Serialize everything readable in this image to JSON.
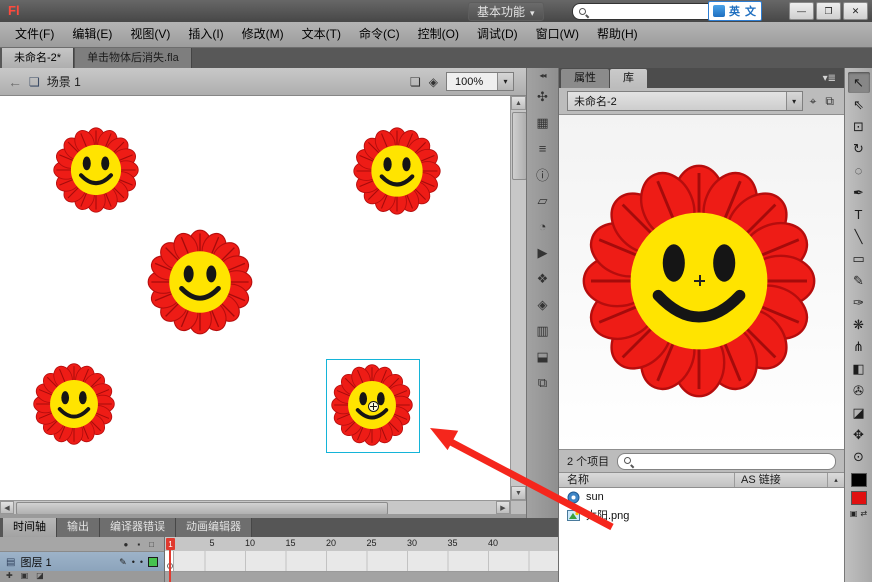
{
  "titlebar": {
    "logo": "Fl",
    "workspace_label": "基本功能",
    "search_placeholder": "",
    "ime_label": "英 文",
    "minimize": "—",
    "maximize": "❐",
    "close": "✕"
  },
  "menubar": {
    "items": [
      "文件(F)",
      "编辑(E)",
      "视图(V)",
      "插入(I)",
      "修改(M)",
      "文本(T)",
      "命令(C)",
      "控制(O)",
      "调试(D)",
      "窗口(W)",
      "帮助(H)"
    ]
  },
  "document_tabs": {
    "tab1": "未命名-2*",
    "tab2": "单击物体后消失.fla"
  },
  "edit_bar": {
    "scene_label": "场景 1",
    "zoom_value": "100%"
  },
  "dock_icons": [
    {
      "name": "color-panel-icon",
      "glyph": "✣"
    },
    {
      "name": "swatches-panel-icon",
      "glyph": "▦"
    },
    {
      "name": "align-panel-icon",
      "glyph": "≡"
    },
    {
      "name": "info-panel-icon",
      "glyph": "ⓘ"
    },
    {
      "name": "transform-panel-icon",
      "glyph": "▱"
    },
    {
      "name": "history-panel-icon",
      "glyph": "◔"
    },
    {
      "name": "motion-presets-panel-icon",
      "glyph": "▶"
    },
    {
      "name": "components-panel-icon",
      "glyph": "❖"
    },
    {
      "name": "code-snippets-panel-icon",
      "glyph": "◈"
    },
    {
      "name": "strings-panel-icon",
      "glyph": "▥"
    },
    {
      "name": "behaviors-panel-icon",
      "glyph": "⬓"
    },
    {
      "name": "project-panel-icon",
      "glyph": "⧉"
    }
  ],
  "right_panel": {
    "tabs": {
      "properties": "属性",
      "library": "库"
    },
    "library": {
      "document_select": "未命名-2",
      "item_count": "2 个项目",
      "search_placeholder": "",
      "columns": {
        "name": "名称",
        "linkage": "AS 链接"
      },
      "items": [
        {
          "name": "sun",
          "type": "symbol"
        },
        {
          "name": "太阳.png",
          "type": "bitmap"
        }
      ]
    }
  },
  "tools": [
    {
      "name": "selection-tool",
      "glyph": "↖",
      "active": true
    },
    {
      "name": "subselection-tool",
      "glyph": "⇖"
    },
    {
      "name": "free-transform-tool",
      "glyph": "⊡"
    },
    {
      "name": "3d-rotation-tool",
      "glyph": "↻"
    },
    {
      "name": "lasso-tool",
      "glyph": "◌"
    },
    {
      "name": "pen-tool",
      "glyph": "✒"
    },
    {
      "name": "text-tool",
      "glyph": "T"
    },
    {
      "name": "line-tool",
      "glyph": "╲"
    },
    {
      "name": "rectangle-tool",
      "glyph": "▭"
    },
    {
      "name": "pencil-tool",
      "glyph": "✎"
    },
    {
      "name": "brush-tool",
      "glyph": "✑"
    },
    {
      "name": "deco-tool",
      "glyph": "❋"
    },
    {
      "name": "bone-tool",
      "glyph": "⋔"
    },
    {
      "name": "paint-bucket-tool",
      "glyph": "◧"
    },
    {
      "name": "eyedropper-tool",
      "glyph": "✇"
    },
    {
      "name": "eraser-tool",
      "glyph": "◪"
    },
    {
      "name": "hand-tool",
      "glyph": "✥"
    },
    {
      "name": "zoom-tool",
      "glyph": "⊙"
    }
  ],
  "bottom_tabs": {
    "timeline": "时间轴",
    "output": "输出",
    "compiler_errors": "编译器错误",
    "motion_editor": "动画编辑器"
  },
  "timeline": {
    "layer_name": "图层 1",
    "playhead": "1",
    "frame_labels": [
      "5",
      "10",
      "15",
      "20",
      "25",
      "30",
      "35",
      "40"
    ]
  }
}
